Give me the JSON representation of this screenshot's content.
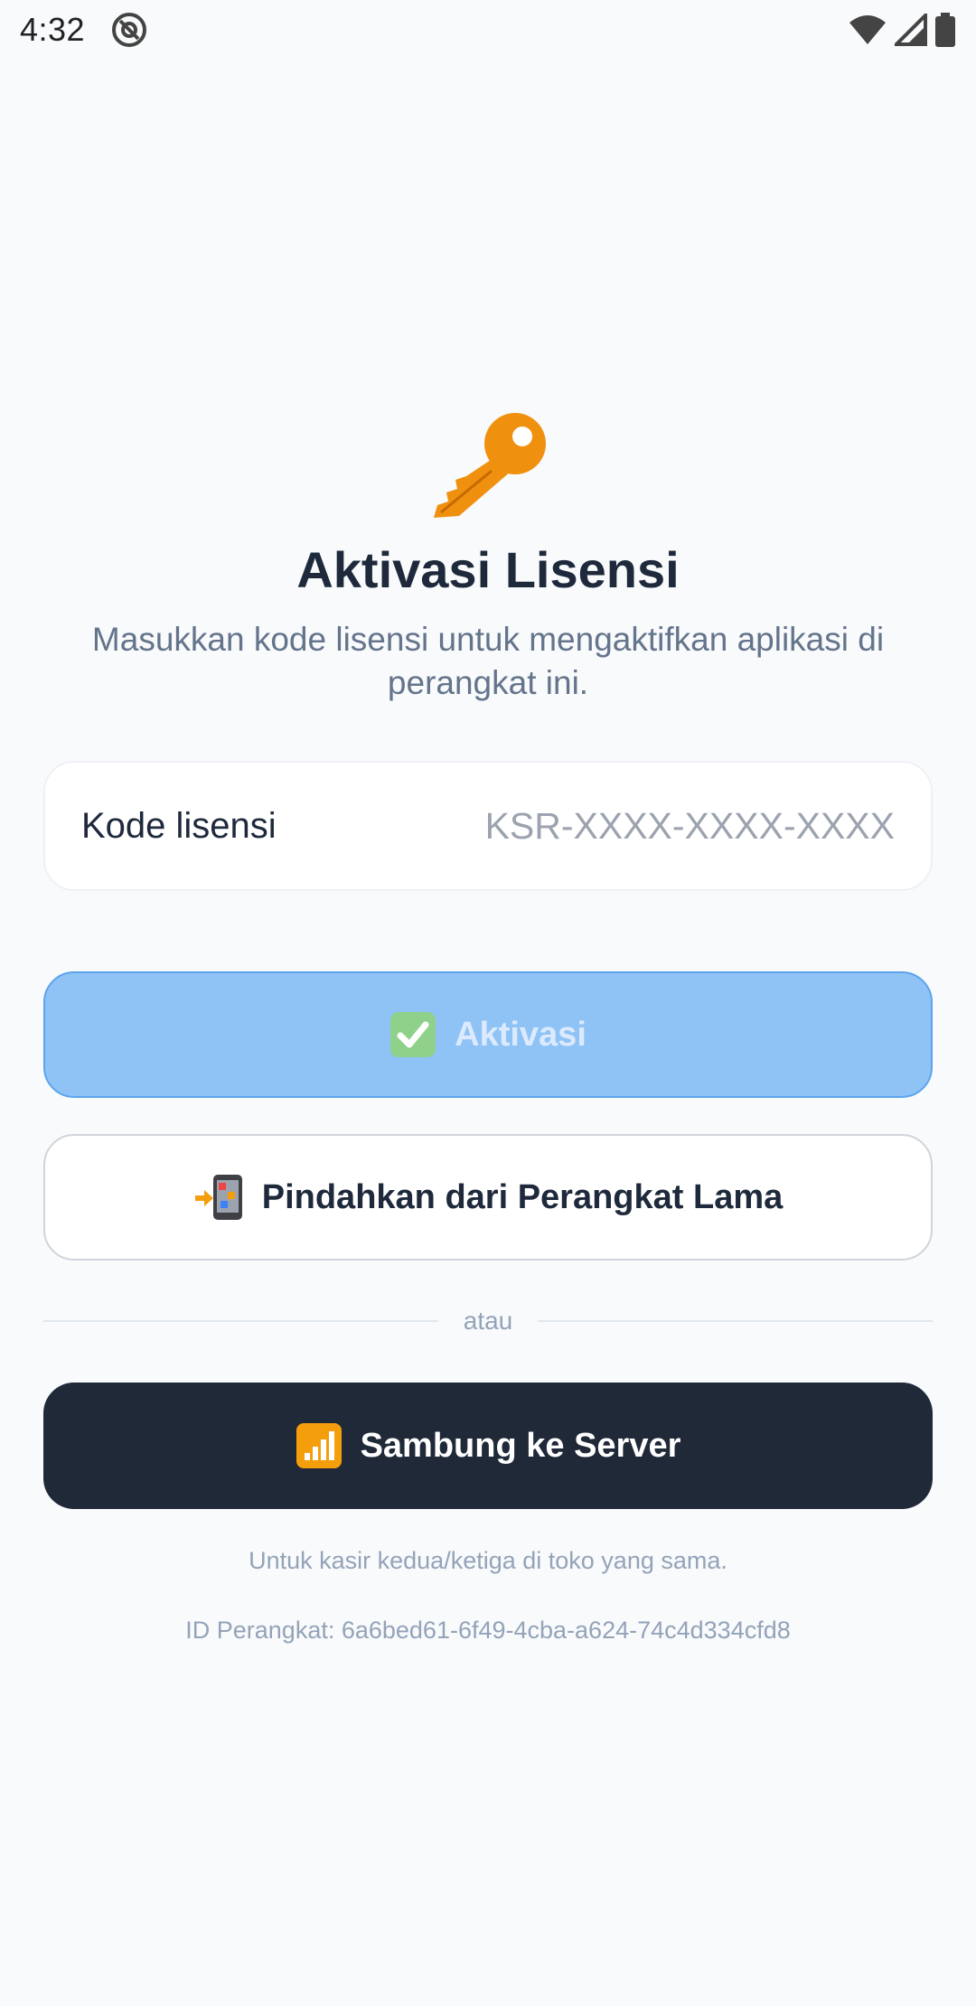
{
  "status_bar": {
    "time": "4:32",
    "icons": [
      "at-sign-icon",
      "wifi-icon",
      "signal-icon",
      "battery-icon"
    ]
  },
  "hero": {
    "icon": "key-icon",
    "title": "Aktivasi Lisensi",
    "subtitle": "Masukkan kode lisensi untuk mengaktifkan aplikasi di perangkat ini."
  },
  "license_field": {
    "label": "Kode lisensi",
    "value": "",
    "placeholder": "KSR-XXXX-XXXX-XXXX"
  },
  "buttons": {
    "activate": {
      "icon": "check-mark-button-icon",
      "label": "Aktivasi",
      "disabled": true
    },
    "transfer": {
      "icon": "mobile-arrow-icon",
      "label": "Pindahkan dari Perangkat Lama"
    },
    "server": {
      "icon": "signal-bars-icon",
      "label": "Sambung ke Server"
    }
  },
  "divider_text": "atau",
  "server_note": "Untuk kasir kedua/ketiga di toko yang sama.",
  "device_id": "ID Perangkat: 6a6bed61-6f49-4cba-a624-74c4d334cfd8",
  "colors": {
    "background": "#f8fafc",
    "accent_disabled": "#90c3f5",
    "dark_button": "#1f2937",
    "key_orange": "#f0900f"
  }
}
